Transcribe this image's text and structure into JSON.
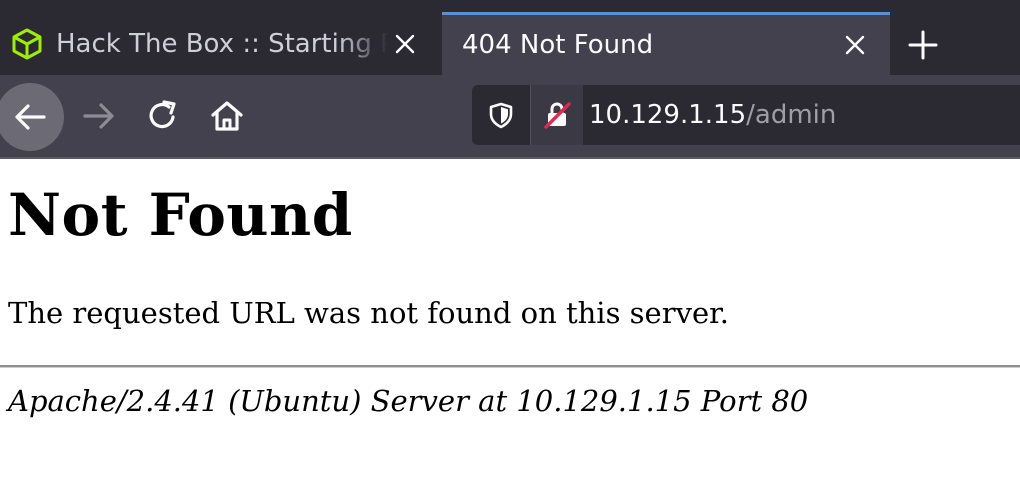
{
  "tabs": [
    {
      "title": "Hack The Box :: Starting P",
      "active": false,
      "favicon": "htb-cube-icon"
    },
    {
      "title": "404 Not Found",
      "active": true,
      "favicon": ""
    }
  ],
  "toolbar": {
    "back": "back-arrow-icon",
    "forward": "forward-arrow-icon",
    "reload": "reload-icon",
    "home": "home-icon"
  },
  "address_bar": {
    "host": "10.129.1.15",
    "path": "/admin"
  },
  "page": {
    "heading": "Not Found",
    "message": "The requested URL was not found on this server.",
    "server_signature": "Apache/2.4.41 (Ubuntu) Server at 10.129.1.15 Port 80"
  },
  "colors": {
    "tabbar_bg": "#2b2a33",
    "toolbar_bg": "#42414d",
    "active_tab_accent": "#5b8fd8",
    "htb_green": "#9fef00",
    "insecure_red": "#e22850"
  }
}
